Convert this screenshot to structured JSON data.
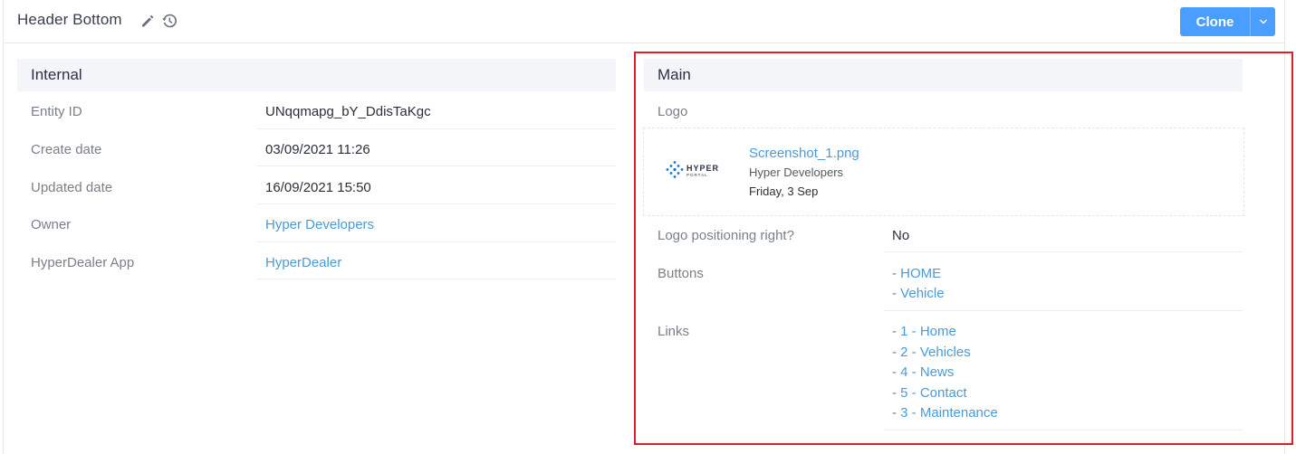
{
  "header": {
    "title": "Header Bottom",
    "clone_label": "Clone"
  },
  "internal": {
    "section_title": "Internal",
    "rows": [
      {
        "label": "Entity ID",
        "value": "UNqqmapg_bY_DdisTaKgc"
      },
      {
        "label": "Create date",
        "value": "03/09/2021 11:26"
      },
      {
        "label": "Updated date",
        "value": "16/09/2021 15:50"
      },
      {
        "label": "Owner",
        "value": "Hyper Developers"
      },
      {
        "label": "HyperDealer App",
        "value": "HyperDealer"
      }
    ]
  },
  "main": {
    "section_title": "Main",
    "logo_label": "Logo",
    "logo_file": {
      "logo_text_line1": "HYPER",
      "logo_text_line2": "PORTAL",
      "name": "Screenshot_1.png",
      "owner": "Hyper Developers",
      "date": "Friday, 3 Sep"
    },
    "logo_positioning": {
      "label": "Logo positioning right?",
      "value": "No"
    },
    "buttons": {
      "label": "Buttons",
      "prefix": "- ",
      "items": [
        "HOME",
        "Vehicle"
      ]
    },
    "links": {
      "label": "Links",
      "prefix": "- ",
      "items": [
        "1 - Home",
        "2 - Vehicles",
        "4 - News",
        "5 - Contact",
        "3 - Maintenance"
      ]
    }
  },
  "colors": {
    "accent": "#4a9eff",
    "link": "#4a9ad8",
    "highlight": "#e01e26"
  }
}
